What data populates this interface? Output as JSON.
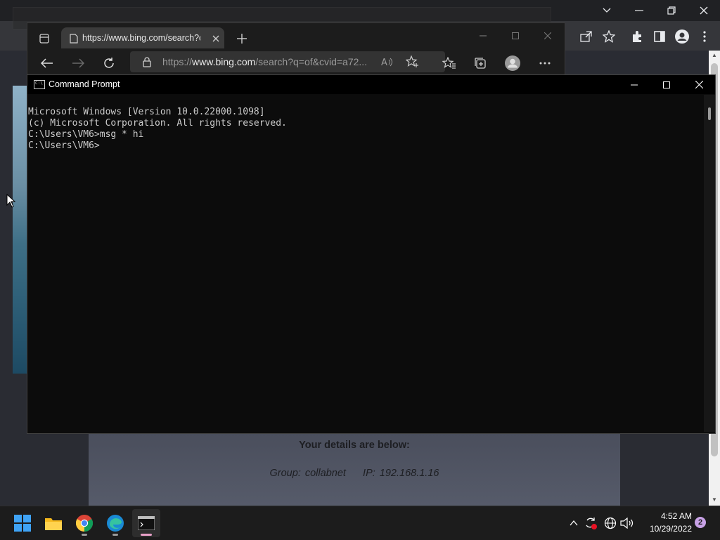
{
  "chrome": {
    "window_controls": [
      "⌄",
      "─",
      "⧉",
      "✕"
    ],
    "toolbar_icons": [
      "share-icon",
      "star-icon",
      "extensions-icon",
      "sidepanel-icon",
      "profile-icon",
      "menu-icon"
    ],
    "page": {
      "details_title": "Your details are below:",
      "group_label": "Group: collabnet",
      "ip_label": "IP: 192.168.1.16"
    }
  },
  "edge": {
    "tab_title": "https://www.bing.com/search?q",
    "address_prefix": "https://",
    "address_host": "www.bing.com",
    "address_rest": "/search?q=of&cvid=a72..."
  },
  "cmd": {
    "title": "Command Prompt",
    "icon_text": "C:\\",
    "lines": [
      "Microsoft Windows [Version 10.0.22000.1098]",
      "(c) Microsoft Corporation. All rights reserved.",
      "",
      "C:\\Users\\VM6>msg * hi",
      "",
      "C:\\Users\\VM6>"
    ]
  },
  "taskbar": {
    "apps": [
      "start",
      "file-explorer",
      "chrome",
      "edge",
      "command-prompt"
    ],
    "clock_time": "4:52 AM",
    "clock_date": "10/29/2022",
    "notification_count": "2"
  },
  "colors": {
    "cmd_bg": "#0c0c0c",
    "cmd_text": "#cccccc",
    "taskbar_bg": "#1c1c1c",
    "accent_underline": "#e8a0c8"
  }
}
